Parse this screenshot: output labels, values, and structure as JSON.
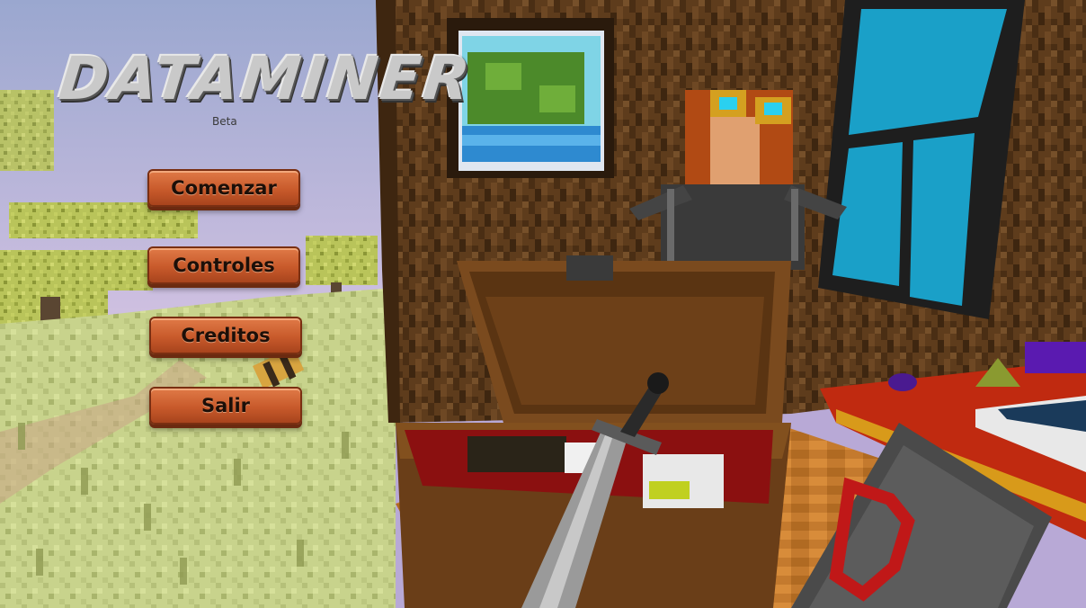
{
  "game": {
    "title": "DATAMINER",
    "subtitle": "Beta"
  },
  "menu": {
    "items": [
      {
        "label": "Comenzar"
      },
      {
        "label": "Controles"
      },
      {
        "label": "Creditos"
      },
      {
        "label": "Salir"
      }
    ]
  },
  "colors": {
    "button_fill": "#c85a2b",
    "button_border": "#7a2f12",
    "sky": "#b8a9d6",
    "grass": "#c9d48a",
    "wood": "#5a3a1a",
    "window_glass": "#1aa0c8"
  }
}
